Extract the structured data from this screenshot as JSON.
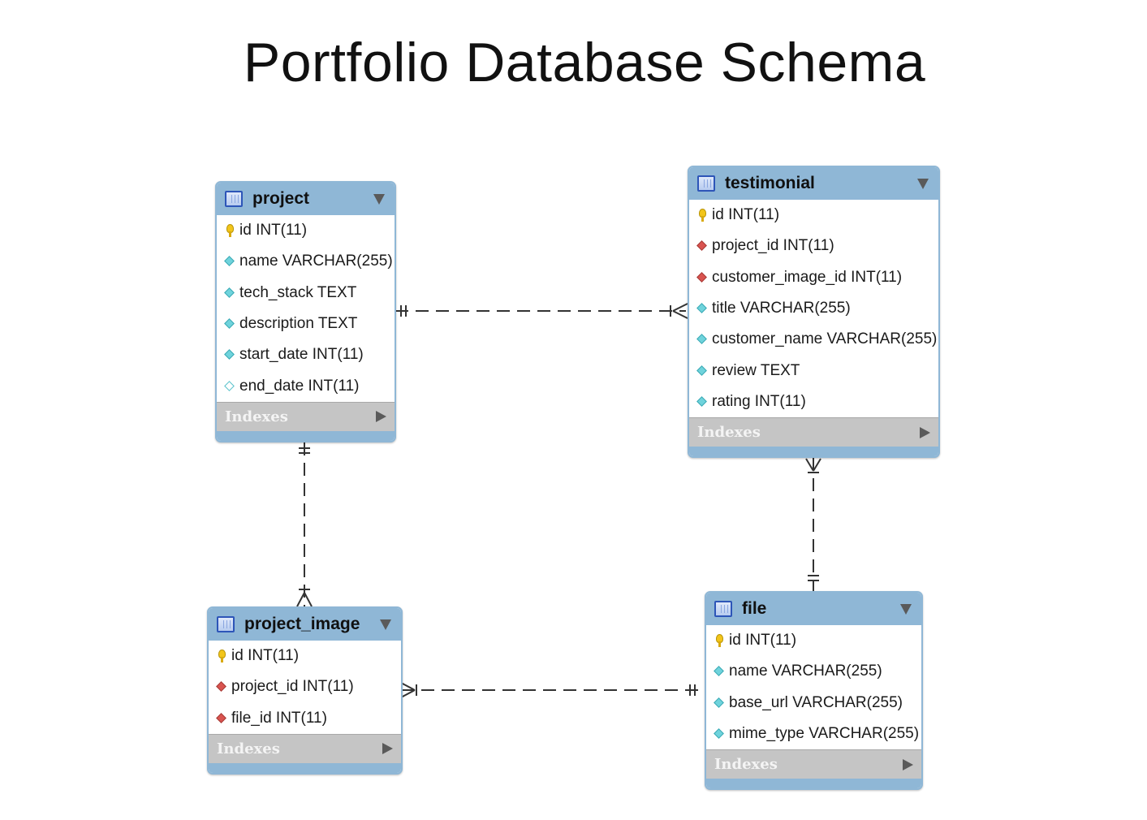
{
  "title": "Portfolio Database Schema",
  "indexes_label": "Indexes",
  "tables": {
    "project": {
      "name": "project",
      "columns": [
        {
          "text": "id INT(11)",
          "icon": "primary-key-icon"
        },
        {
          "text": "name VARCHAR(255)",
          "icon": "attribute-icon"
        },
        {
          "text": "tech_stack TEXT",
          "icon": "attribute-icon"
        },
        {
          "text": "description TEXT",
          "icon": "attribute-icon"
        },
        {
          "text": "start_date INT(11)",
          "icon": "attribute-icon"
        },
        {
          "text": "end_date INT(11)",
          "icon": "nullable-attribute-icon"
        }
      ]
    },
    "testimonial": {
      "name": "testimonial",
      "columns": [
        {
          "text": "id INT(11)",
          "icon": "primary-key-icon"
        },
        {
          "text": "project_id INT(11)",
          "icon": "foreign-key-icon"
        },
        {
          "text": "customer_image_id INT(11)",
          "icon": "foreign-key-icon"
        },
        {
          "text": "title VARCHAR(255)",
          "icon": "attribute-icon"
        },
        {
          "text": "customer_name VARCHAR(255)",
          "icon": "attribute-icon"
        },
        {
          "text": "review TEXT",
          "icon": "attribute-icon"
        },
        {
          "text": "rating INT(11)",
          "icon": "attribute-icon"
        }
      ]
    },
    "project_image": {
      "name": "project_image",
      "columns": [
        {
          "text": "id INT(11)",
          "icon": "primary-key-icon"
        },
        {
          "text": "project_id INT(11)",
          "icon": "foreign-key-icon"
        },
        {
          "text": "file_id INT(11)",
          "icon": "foreign-key-icon"
        }
      ]
    },
    "file": {
      "name": "file",
      "columns": [
        {
          "text": "id INT(11)",
          "icon": "primary-key-icon"
        },
        {
          "text": "name VARCHAR(255)",
          "icon": "attribute-icon"
        },
        {
          "text": "base_url VARCHAR(255)",
          "icon": "attribute-icon"
        },
        {
          "text": "mime_type VARCHAR(255)",
          "icon": "attribute-icon"
        }
      ]
    }
  },
  "relationships": [
    {
      "from": "project",
      "to": "testimonial",
      "from_cardinality": "one-and-only-one",
      "to_cardinality": "zero-or-many"
    },
    {
      "from": "project",
      "to": "project_image",
      "from_cardinality": "one-and-only-one",
      "to_cardinality": "one-or-many"
    },
    {
      "from": "file",
      "to": "project_image",
      "from_cardinality": "one-and-only-one",
      "to_cardinality": "one-or-many"
    },
    {
      "from": "file",
      "to": "testimonial",
      "from_cardinality": "one-and-only-one",
      "to_cardinality": "one-or-many"
    }
  ],
  "colors": {
    "header": "#8fb7d6",
    "indexes_bar": "#c5c5c5",
    "primary_key": "#f2c51a",
    "foreign_key": "#d9534f",
    "attribute": "#6fd3dc"
  }
}
